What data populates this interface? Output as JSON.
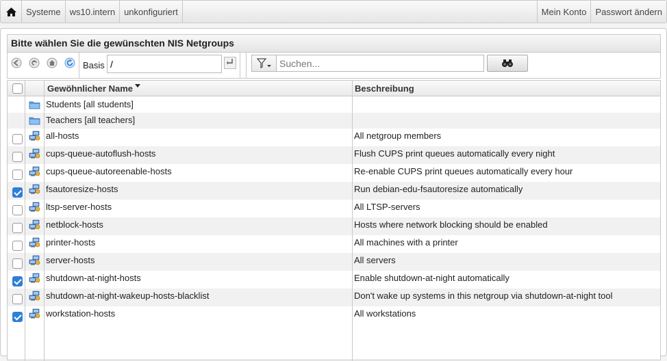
{
  "topbar": {
    "items": [
      "Systeme",
      "ws10.intern",
      "unkonfiguriert"
    ],
    "right_items": [
      "Mein Konto",
      "Passwort ändern"
    ]
  },
  "panel": {
    "title": "Bitte wählen Sie die gewünschten NIS Netgroups"
  },
  "toolbar": {
    "basis_label": "Basis",
    "basis_value": "/",
    "search_placeholder": "Suchen..."
  },
  "table": {
    "columns": [
      "Gewöhnlicher Name",
      "Beschreibung"
    ],
    "rows": [
      {
        "type": "folder",
        "name": "Students [all students]",
        "desc": "",
        "checked": false
      },
      {
        "type": "folder",
        "name": "Teachers [all teachers]",
        "desc": "",
        "checked": false
      },
      {
        "type": "group",
        "name": "all-hosts",
        "desc": "All netgroup members",
        "checked": false
      },
      {
        "type": "group",
        "name": "cups-queue-autoflush-hosts",
        "desc": "Flush CUPS print queues automatically every night",
        "checked": false
      },
      {
        "type": "group",
        "name": "cups-queue-autoreenable-hosts",
        "desc": "Re-enable CUPS print queues automatically every hour",
        "checked": false
      },
      {
        "type": "group",
        "name": "fsautoresize-hosts",
        "desc": "Run debian-edu-fsautoresize automatically",
        "checked": true
      },
      {
        "type": "group",
        "name": "ltsp-server-hosts",
        "desc": "All LTSP-servers",
        "checked": false
      },
      {
        "type": "group",
        "name": "netblock-hosts",
        "desc": "Hosts where network blocking should be enabled",
        "checked": false
      },
      {
        "type": "group",
        "name": "printer-hosts",
        "desc": "All machines with a printer",
        "checked": false
      },
      {
        "type": "group",
        "name": "server-hosts",
        "desc": "All servers",
        "checked": false
      },
      {
        "type": "group",
        "name": "shutdown-at-night-hosts",
        "desc": "Enable shutdown-at-night automatically",
        "checked": true
      },
      {
        "type": "group",
        "name": "shutdown-at-night-wakeup-hosts-blacklist",
        "desc": "Don't wake up systems in this netgroup via shutdown-at-night tool",
        "checked": false
      },
      {
        "type": "group",
        "name": "workstation-hosts",
        "desc": "All workstations",
        "checked": true
      }
    ]
  },
  "colors": {
    "accent": "#2f7fd7",
    "border": "#c8c8c8",
    "row_alt": "#f1f1f1"
  },
  "icons": {
    "home": "home-icon",
    "folder": "folder-icon",
    "group": "netgroup-icon",
    "search": "binoculars-icon",
    "filter": "filter-icon"
  }
}
